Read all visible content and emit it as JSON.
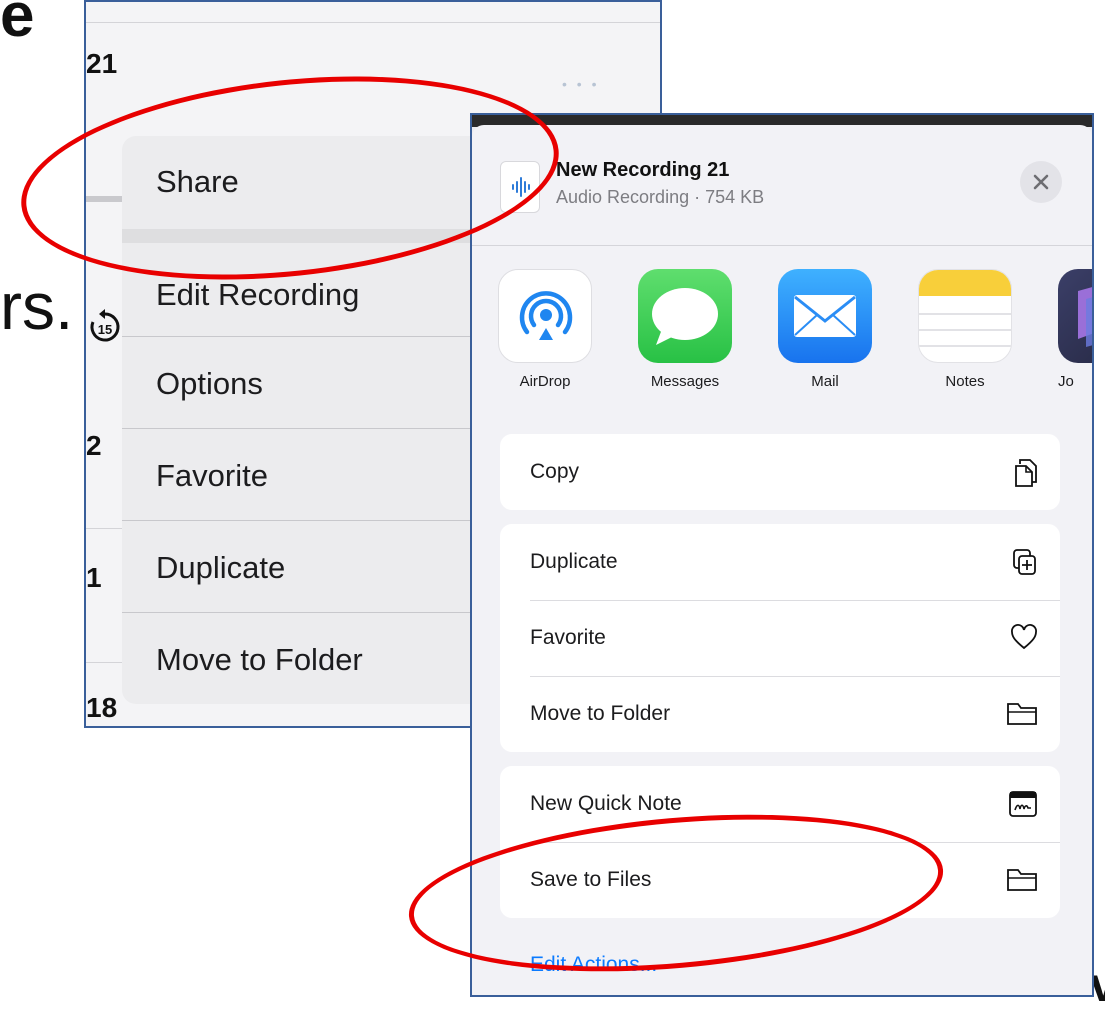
{
  "background": {
    "fragment_top": "e",
    "fragment_mid": "rs.",
    "fragment_right": "v"
  },
  "left_panel": {
    "row_numbers": [
      "21",
      "2",
      "1",
      "18"
    ],
    "more_dots": "• • •",
    "skip_label": "15",
    "menu": {
      "items": [
        "Share",
        "Edit Recording",
        "Options",
        "Favorite",
        "Duplicate",
        "Move to Folder"
      ]
    }
  },
  "share_sheet": {
    "title": "New Recording 21",
    "subtitle": "Audio Recording · 754 KB",
    "apps": [
      {
        "name": "AirDrop",
        "icon": "airdrop-icon"
      },
      {
        "name": "Messages",
        "icon": "messages-icon"
      },
      {
        "name": "Mail",
        "icon": "mail-icon"
      },
      {
        "name": "Notes",
        "icon": "notes-icon"
      },
      {
        "name": "Jo",
        "icon": "app-icon"
      }
    ],
    "actions": [
      {
        "label": "Copy",
        "icon": "copy-icon"
      },
      {
        "label": "Duplicate",
        "icon": "duplicate-icon"
      },
      {
        "label": "Favorite",
        "icon": "heart-icon"
      },
      {
        "label": "Move to Folder",
        "icon": "folder-icon"
      },
      {
        "label": "New Quick Note",
        "icon": "quick-note-icon"
      },
      {
        "label": "Save to Files",
        "icon": "folder-icon"
      }
    ],
    "edit_actions": "Edit Actions..."
  },
  "colors": {
    "annotation_red": "#e80000",
    "frame_blue": "#3a5f9a",
    "link_blue": "#0a7aff",
    "messages_green": "#34c759",
    "mail_blue": "#1e8cf6"
  }
}
